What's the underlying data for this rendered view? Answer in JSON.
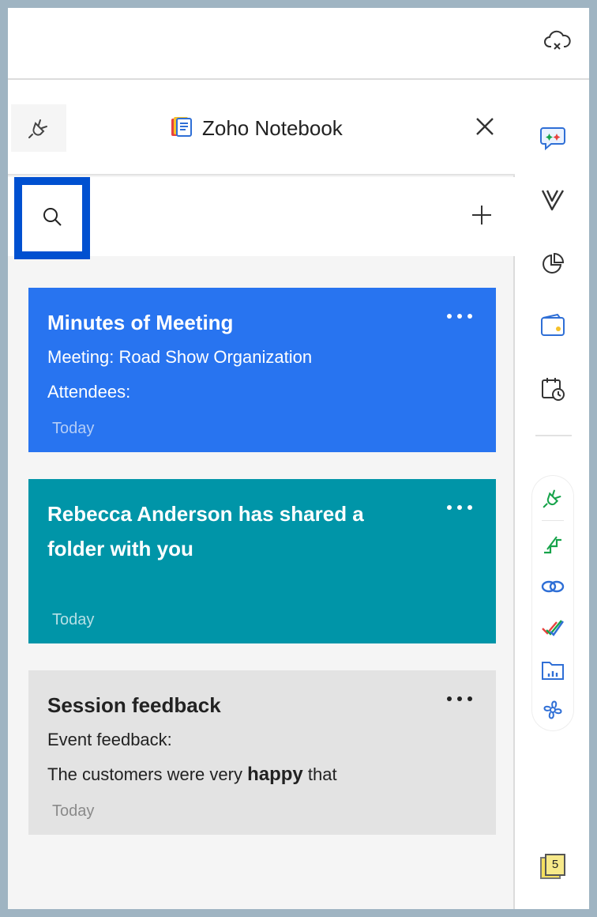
{
  "header": {
    "title": "Zoho Notebook",
    "icons": {
      "cloud": "cloud-x-icon",
      "plug": "plug-icon",
      "close": "close-icon",
      "logo": "notebook-logo-icon"
    }
  },
  "toolbar": {
    "search_icon": "search-icon",
    "add_icon": "plus-icon"
  },
  "notes": [
    {
      "title": "Minutes of Meeting",
      "line1": "Meeting: Road Show Organization",
      "line2": "Attendees:",
      "date": "Today",
      "color": "#2874f0"
    },
    {
      "title": "Rebecca Anderson has shared a folder with you",
      "date": "Today",
      "color": "#0095a8"
    },
    {
      "title": "Session feedback",
      "line1": "Event feedback:",
      "line2_pre": "The customers were very ",
      "line2_bold": "happy",
      "line2_post": " that",
      "date": "Today",
      "color": "#e3e3e3"
    }
  ],
  "rail": {
    "top_icons": [
      "chat-icon",
      "vtiger-icon",
      "pie-chart-icon",
      "wallet-icon",
      "calendar-clock-icon"
    ],
    "group_icons": [
      "plug-green-icon",
      "route-icon",
      "link-icon",
      "checkmarks-icon",
      "folder-chart-icon",
      "flower-icon"
    ],
    "badge": "5"
  }
}
